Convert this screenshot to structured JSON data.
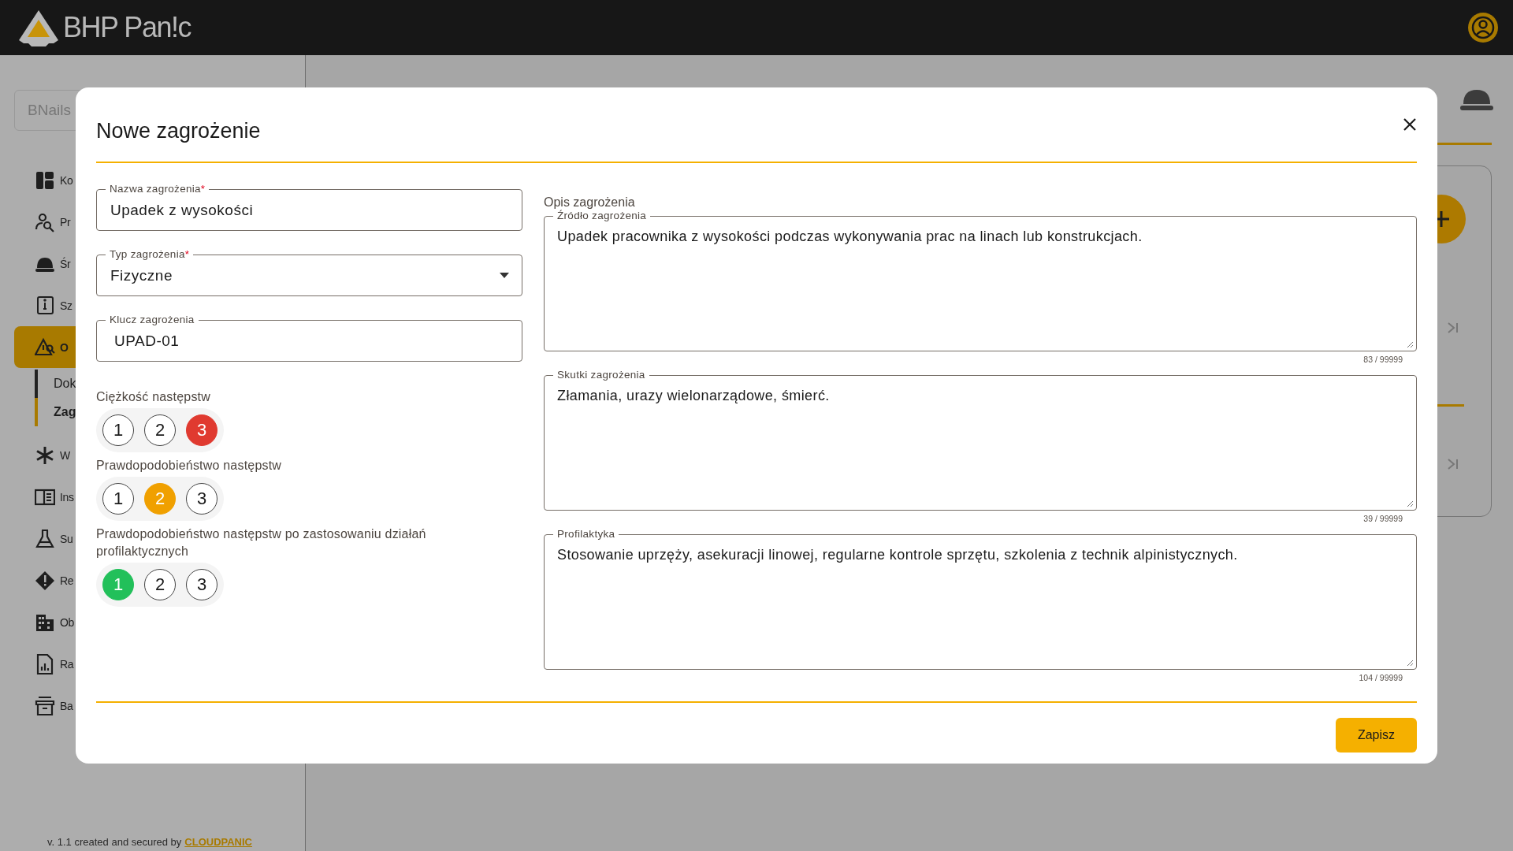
{
  "header": {
    "logo_text": "BHP Pan!c"
  },
  "sidebar": {
    "workspace": "BNails",
    "items": [
      {
        "label": "Ko",
        "active": false
      },
      {
        "label": "Pr",
        "active": false
      },
      {
        "label": "Śr",
        "active": false
      },
      {
        "label": "Sz",
        "active": false
      },
      {
        "label": "O",
        "active": true,
        "children": [
          {
            "label": "Dok",
            "selected": false
          },
          {
            "label": "Zag",
            "selected": true
          }
        ]
      },
      {
        "label": "W",
        "active": false
      },
      {
        "label": "Ins",
        "active": false
      },
      {
        "label": "Su",
        "active": false
      },
      {
        "label": "Re",
        "active": false
      },
      {
        "label": "Ob",
        "active": false
      },
      {
        "label": "Ra",
        "active": false
      },
      {
        "label": "Ba",
        "active": false
      }
    ],
    "footer": {
      "text": "v. 1.1 created and secured by",
      "link": "CLOUDPANIC"
    }
  },
  "modal": {
    "title": "Nowe zagrożenie",
    "fields": [
      {
        "kind": "text",
        "label": "Nazwa zagrożenia",
        "required_mark": "*",
        "value": "Upadek z wysokości"
      },
      {
        "kind": "select",
        "label": "Typ zagrożenia",
        "required_mark": "*",
        "value": "Fizyczne"
      },
      {
        "kind": "text",
        "label": "Klucz zagrożenia",
        "value": "UPAD-01"
      }
    ],
    "ratings": [
      {
        "label": "Ciężkość następstw",
        "color": "#e03a30",
        "options": [
          {
            "label": "1",
            "selected": false
          },
          {
            "label": "2",
            "selected": false
          },
          {
            "label": "3",
            "selected": true
          }
        ]
      },
      {
        "label": "Prawdopodobieństwo następstw",
        "color": "#f0a000",
        "options": [
          {
            "label": "1",
            "selected": false
          },
          {
            "label": "2",
            "selected": true
          },
          {
            "label": "3",
            "selected": false
          }
        ]
      },
      {
        "label": "Prawdopodobieństwo następstw po zastosowaniu działań profilaktycznych",
        "color": "#22c05a",
        "options": [
          {
            "label": "1",
            "selected": true
          },
          {
            "label": "2",
            "selected": false
          },
          {
            "label": "3",
            "selected": false
          }
        ]
      }
    ],
    "description": {
      "heading": "Opis zagrożenia",
      "areas": [
        {
          "label": "Źródło zagrożenia",
          "value": "Upadek pracownika z wysokości podczas wykonywania prac na linach lub konstrukcjach.",
          "counter": "83 / 99999"
        },
        {
          "label": "Skutki zagrożenia",
          "value": "Złamania, urazy wielonarządowe, śmierć.",
          "counter": "39 / 99999"
        },
        {
          "label": "Profilaktyka",
          "value": "Stosowanie uprzęży, asekuracji linowej, regularne kontrole sprzętu, szkolenia z technik alpinistycznych.",
          "counter": "104 / 99999"
        }
      ]
    },
    "save_button": "Zapisz"
  }
}
